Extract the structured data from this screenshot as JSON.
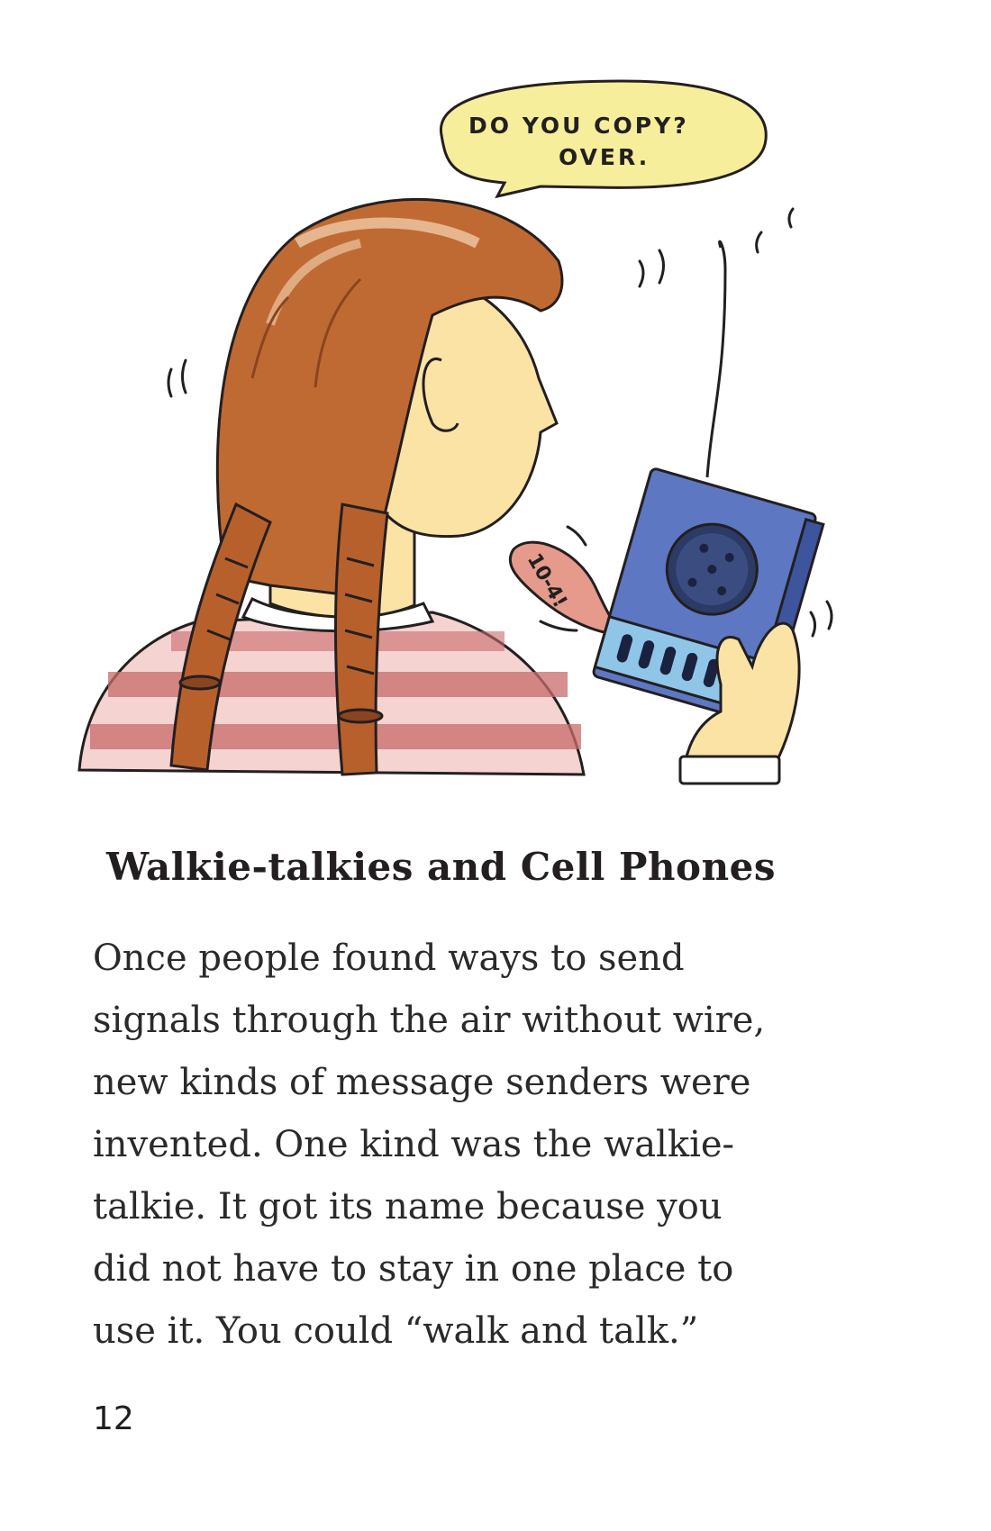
{
  "illustration": {
    "speech_bubble": {
      "line1": "DO YOU COPY?",
      "line2": "OVER."
    },
    "radio_bubble": "10-4!"
  },
  "heading": "Walkie-talkies and Cell Phones",
  "body_lines": [
    "Once people found ways to send",
    "signals through the air without wire,",
    "new kinds of message senders were",
    "invented. One kind was the walkie-",
    "talkie. It got its name because you",
    "did not have to stay in one place to",
    "use it. You could “walk and talk.”"
  ],
  "page_number": "12",
  "colors": {
    "hair": "#c06a33",
    "skin": "#fbe3a6",
    "shirt_stripe": "#c96b6b",
    "radio_blue": "#5d77c2",
    "bubble_yellow": "#f6ee9a",
    "bubble_pink": "#e59a8c"
  }
}
